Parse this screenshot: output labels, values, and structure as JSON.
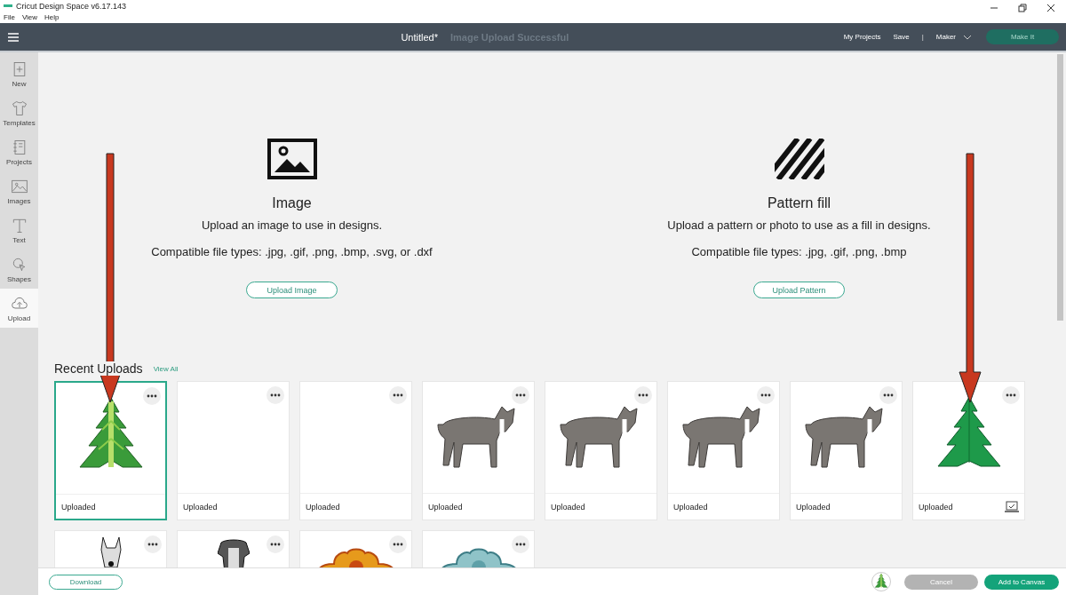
{
  "window": {
    "title": "Cricut Design Space  v6.17.143"
  },
  "menu": [
    "File",
    "View",
    "Help"
  ],
  "header": {
    "title": "Untitled*",
    "notice": "Image Upload Successful",
    "links": [
      "My Projects",
      "Save"
    ],
    "separator": "|",
    "machine": "Maker",
    "make_button": "Make It"
  },
  "sidebar": {
    "items": [
      {
        "label": "New",
        "kind": "new",
        "selected": false
      },
      {
        "label": "Templates",
        "kind": "shirt",
        "selected": false
      },
      {
        "label": "Projects",
        "kind": "notebook",
        "selected": false
      },
      {
        "label": "Images",
        "kind": "image",
        "selected": false
      },
      {
        "label": "Text",
        "kind": "text",
        "selected": false
      },
      {
        "label": "Shapes",
        "kind": "shapes",
        "selected": false
      },
      {
        "label": "Upload",
        "kind": "upload",
        "selected": true
      }
    ]
  },
  "upload_options": [
    {
      "kind": "image",
      "title": "Image",
      "description": "Upload an image to use in designs.",
      "file_types": "Compatible file types: .jpg, .gif, .png, .bmp, .svg, or .dxf",
      "button": "Upload Image"
    },
    {
      "kind": "pattern",
      "title": "Pattern fill",
      "description": "Upload a pattern or photo to use as a fill in designs.",
      "file_types": "Compatible file types: .jpg, .gif, .png, .bmp",
      "button": "Upload Pattern"
    }
  ],
  "recent_uploads": {
    "title": "Recent Uploads",
    "view_all": "View All",
    "items": [
      {
        "kind": "tree",
        "label": "Uploaded",
        "selected": true,
        "checked": false
      },
      {
        "kind": "blank",
        "label": "Uploaded",
        "selected": false,
        "checked": false
      },
      {
        "kind": "blank",
        "label": "Uploaded",
        "selected": false,
        "checked": false
      },
      {
        "kind": "dog",
        "label": "Uploaded",
        "selected": false,
        "checked": false
      },
      {
        "kind": "dog",
        "label": "Uploaded",
        "selected": false,
        "checked": false
      },
      {
        "kind": "dog",
        "label": "Uploaded",
        "selected": false,
        "checked": false
      },
      {
        "kind": "dog",
        "label": "Uploaded",
        "selected": false,
        "checked": false
      },
      {
        "kind": "tree_solid",
        "label": "Uploaded",
        "selected": false,
        "checked": true
      },
      {
        "kind": "dog_head",
        "selected": false
      },
      {
        "kind": "dog_head_dark",
        "selected": false
      },
      {
        "kind": "mandala_orange",
        "selected": false
      },
      {
        "kind": "mandala_blue",
        "selected": false
      }
    ]
  },
  "footer": {
    "download": "Download",
    "cancel": "Cancel",
    "add": "Add to Canvas"
  }
}
